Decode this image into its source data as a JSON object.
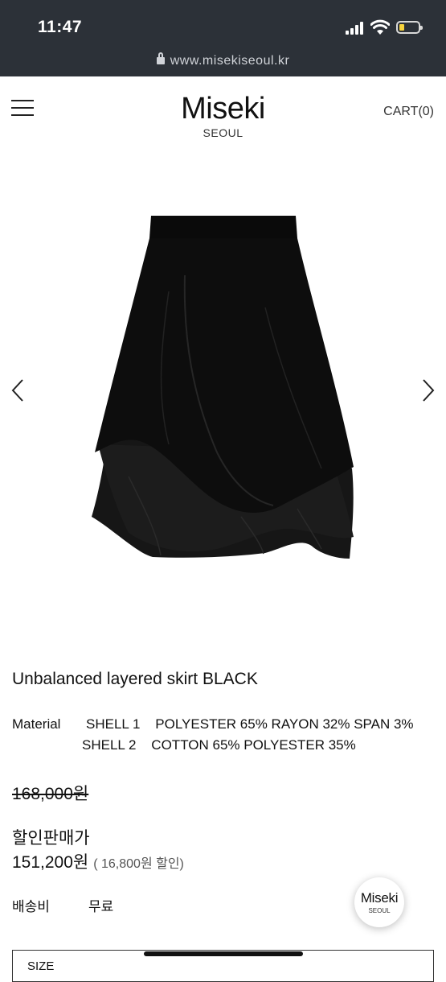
{
  "status_bar": {
    "time": "11:47",
    "url": "www.misekiseoul.kr"
  },
  "header": {
    "brand_name": "Miseki",
    "brand_sub": "SEOUL",
    "cart_label": "CART",
    "cart_count": "(0)"
  },
  "product": {
    "title": "Unbalanced layered skirt BLACK",
    "material_label": "Material",
    "material_lines": [
      "SHELL 1    POLYESTER 65% RAYON 32% SPAN 3%",
      "SHELL 2    COTTON 65% POLYESTER 35%"
    ],
    "original_price": "168,000원",
    "sale_label": "할인판매가",
    "sale_price": "151,200원",
    "discount_note": "( 16,800원 할인)",
    "shipping_label": "배송비",
    "shipping_value": "무료"
  },
  "floating_badge": {
    "name": "Miseki",
    "sub": "SEOUL"
  },
  "size_selector": {
    "label": "SIZE"
  },
  "icons": {
    "menu": "hamburger-menu-icon",
    "prev": "chevron-left-icon",
    "next": "chevron-right-icon",
    "lock": "lock-icon"
  },
  "colors": {
    "status_bar_bg": "#2c3138",
    "battery_level": "#f6d33c",
    "text": "#111111"
  }
}
